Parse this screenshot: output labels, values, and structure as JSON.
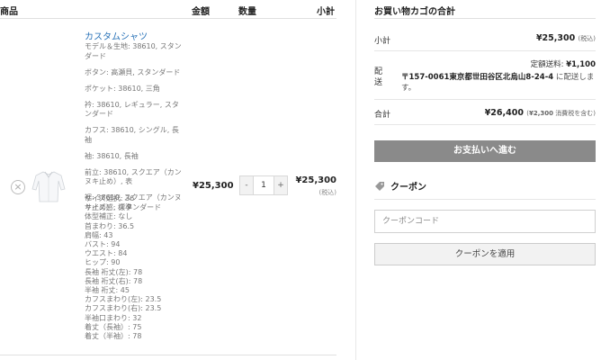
{
  "table": {
    "headers": {
      "product": "商品",
      "price": "金額",
      "quantity": "数量",
      "subtotal": "小計"
    }
  },
  "item": {
    "name": "カスタムシャツ",
    "attributes": [
      "モデル＆生地: 38610, スタンダード",
      "ボタン: 高瀬貝, スタンダード",
      "ポケット: 38610, 三角",
      "衿: 38610, レギュラー, スタンダード",
      "カフス: 38610, シングル, 長袖",
      "袖: 38610, 長袖",
      "前立: 38610, スクエア（カンヌキ止め）, 表",
      "裾: 38610, スクエア（カンヌキ止め）, スタンダード"
    ],
    "measurements": [
      "サイズ選択: 36",
      "サイズ感: 標準",
      "体型補正: なし",
      "首まわり: 36.5",
      "肩幅: 43",
      "バスト: 94",
      "ウエスト: 84",
      "ヒップ: 90",
      "長袖 裄丈(左): 78",
      "長袖 裄丈(右): 78",
      "半袖 裄丈: 45",
      "カフスまわり(左): 23.5",
      "カフスまわり(右): 23.5",
      "半袖口まわり: 32",
      "着丈（長袖）: 75",
      "着丈（半袖）: 78"
    ],
    "remove_icon": "×",
    "price": "¥25,300",
    "qty_minus": "-",
    "qty_plus": "+",
    "qty_value": "1",
    "subtotal": "¥25,300",
    "subtotal_tax_note": "(税込)"
  },
  "summary": {
    "title": "お買い物カゴの合計",
    "subtotal_label": "小計",
    "subtotal_value": "¥25,300",
    "subtotal_tax_note": "(税込)",
    "shipping_label": "配送",
    "shipping_fee_label": "定額送料:",
    "shipping_fee_value": "¥1,100",
    "shipping_address": "〒157-0061東京都世田谷区北烏山8-24-4",
    "shipping_address_suffix": " に配送します。",
    "total_label": "合計",
    "total_value": "¥26,400",
    "total_tax_note_amount": "¥2,300",
    "total_tax_note_text": " 消費税を含む)",
    "total_tax_note_open": "(",
    "checkout_button": "お支払いへ進む"
  },
  "coupon": {
    "title": "クーポン",
    "placeholder": "クーポンコード",
    "apply_button": "クーポンを適用"
  },
  "colors": {
    "link": "#2a73b8",
    "checkout_bg": "#8a8a8a"
  }
}
